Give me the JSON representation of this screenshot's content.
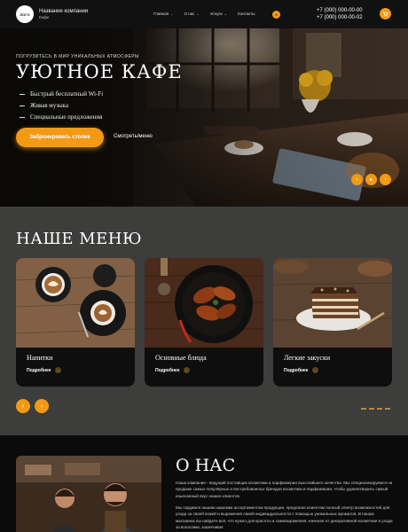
{
  "header": {
    "logo_text": "ЛОГО",
    "company_name": "Название компании",
    "company_sub": "Кафе",
    "nav": [
      {
        "label": "Главная",
        "chevron": true
      },
      {
        "label": "О нас",
        "chevron": true
      },
      {
        "label": "Услуги",
        "chevron": true
      },
      {
        "label": "Контакты",
        "chevron": false
      }
    ],
    "nav_badge": "8",
    "phones": [
      "+7 (000) 000-00-00",
      "+7 (000) 000-00-02"
    ],
    "cart_icon": "cart-icon"
  },
  "hero": {
    "eyebrow": "ПОГРУЗИТЕСЬ В МИР УНИКАЛЬНЫХ АТМОСФЕРЫ",
    "title": "УЮТНОЕ КАФЕ",
    "features": [
      "Быстрый бесплатный Wi-Fi",
      "Живая музыка",
      "Специальные предложения"
    ],
    "cta_label": "Забронировать столик",
    "more_label": "Смотреть/меню"
  },
  "menu": {
    "title": "НАШЕ МЕНЮ",
    "cards": [
      {
        "title": "Напитки",
        "more": "Подробнее"
      },
      {
        "title": "Основные блюда",
        "more": "Подробнее"
      },
      {
        "title": "Легкие закуски",
        "more": "Подробнее"
      }
    ]
  },
  "about": {
    "title": "О НАС",
    "p1": "Наша компания - ведущий поставщик косметики и парфюмерии высочайшего качества. Мы специализируемся на продаже самых популярных и востребованных брендов косметики и парфюмерии, чтобы удовлетворить самый изысканный вкус наших клиентов.",
    "p2": "Мы гордимся нашим широким ассортиментом продукции, предлагая клиентам полный спектр возможностей для ухода за своей кожей и выражения своей индивидуальности с помощью уникальных ароматов. В наших магазинах вы найдете всё, что нужно для красоты и самовыражения, начиная от декоративной косметики и ухода за волосами, заканчивая"
  },
  "colors": {
    "accent": "#f29a13",
    "menu_bg": "#3d3d3c",
    "dark": "#0b0b0b"
  }
}
